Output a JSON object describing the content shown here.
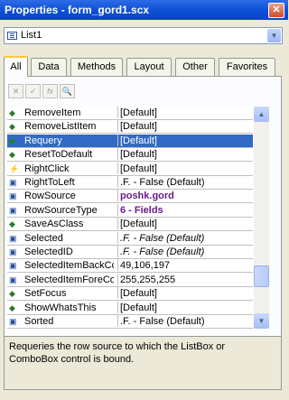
{
  "window": {
    "title": "Properties - form_gord1.scx",
    "close_glyph": "✕"
  },
  "object_select": {
    "value": "List1",
    "icon": "listbox-icon"
  },
  "tabs": [
    {
      "label": "All",
      "active": true
    },
    {
      "label": "Data"
    },
    {
      "label": "Methods"
    },
    {
      "label": "Layout"
    },
    {
      "label": "Other"
    },
    {
      "label": "Favorites"
    }
  ],
  "toolbar": [
    {
      "name": "cancel-icon",
      "glyph": "✕"
    },
    {
      "name": "accept-icon",
      "glyph": "✓"
    },
    {
      "name": "function-icon",
      "glyph": "fx"
    },
    {
      "name": "zoom-icon",
      "glyph": "🔍"
    }
  ],
  "properties": [
    {
      "name": "RemoveItem",
      "value": "[Default]",
      "kind": "method"
    },
    {
      "name": "RemoveListItem",
      "value": "[Default]",
      "kind": "method"
    },
    {
      "name": "Requery",
      "value": "[Default]",
      "kind": "method",
      "selected": true
    },
    {
      "name": "ResetToDefault",
      "value": "[Default]",
      "kind": "method"
    },
    {
      "name": "RightClick",
      "value": "[Default]",
      "kind": "event"
    },
    {
      "name": "RightToLeft",
      "value": ".F. - False (Default)",
      "kind": "prop"
    },
    {
      "name": "RowSource",
      "value": "poshk.gord",
      "kind": "prop",
      "bold": true
    },
    {
      "name": "RowSourceType",
      "value": "6 - Fields",
      "kind": "prop",
      "bold": true
    },
    {
      "name": "SaveAsClass",
      "value": "[Default]",
      "kind": "method"
    },
    {
      "name": "Selected",
      "value": ".F. - False (Default)",
      "kind": "prop",
      "italic": true
    },
    {
      "name": "SelectedID",
      "value": ".F. - False (Default)",
      "kind": "prop",
      "italic": true
    },
    {
      "name": "SelectedItemBackColor",
      "value": "49,106,197",
      "kind": "prop"
    },
    {
      "name": "SelectedItemForeColor",
      "value": "255,255,255",
      "kind": "prop"
    },
    {
      "name": "SetFocus",
      "value": "[Default]",
      "kind": "method"
    },
    {
      "name": "ShowWhatsThis",
      "value": "[Default]",
      "kind": "method"
    },
    {
      "name": "Sorted",
      "value": ".F. - False (Default)",
      "kind": "prop"
    }
  ],
  "description": "Requeries the row source to which the ListBox or ComboBox control is bound.",
  "scrollbar": {
    "up_glyph": "▲",
    "down_glyph": "▼"
  },
  "colors": {
    "selection": "#316ac5",
    "titlebar": "#0b4fd6",
    "bold_value": "#6a1a8a"
  }
}
